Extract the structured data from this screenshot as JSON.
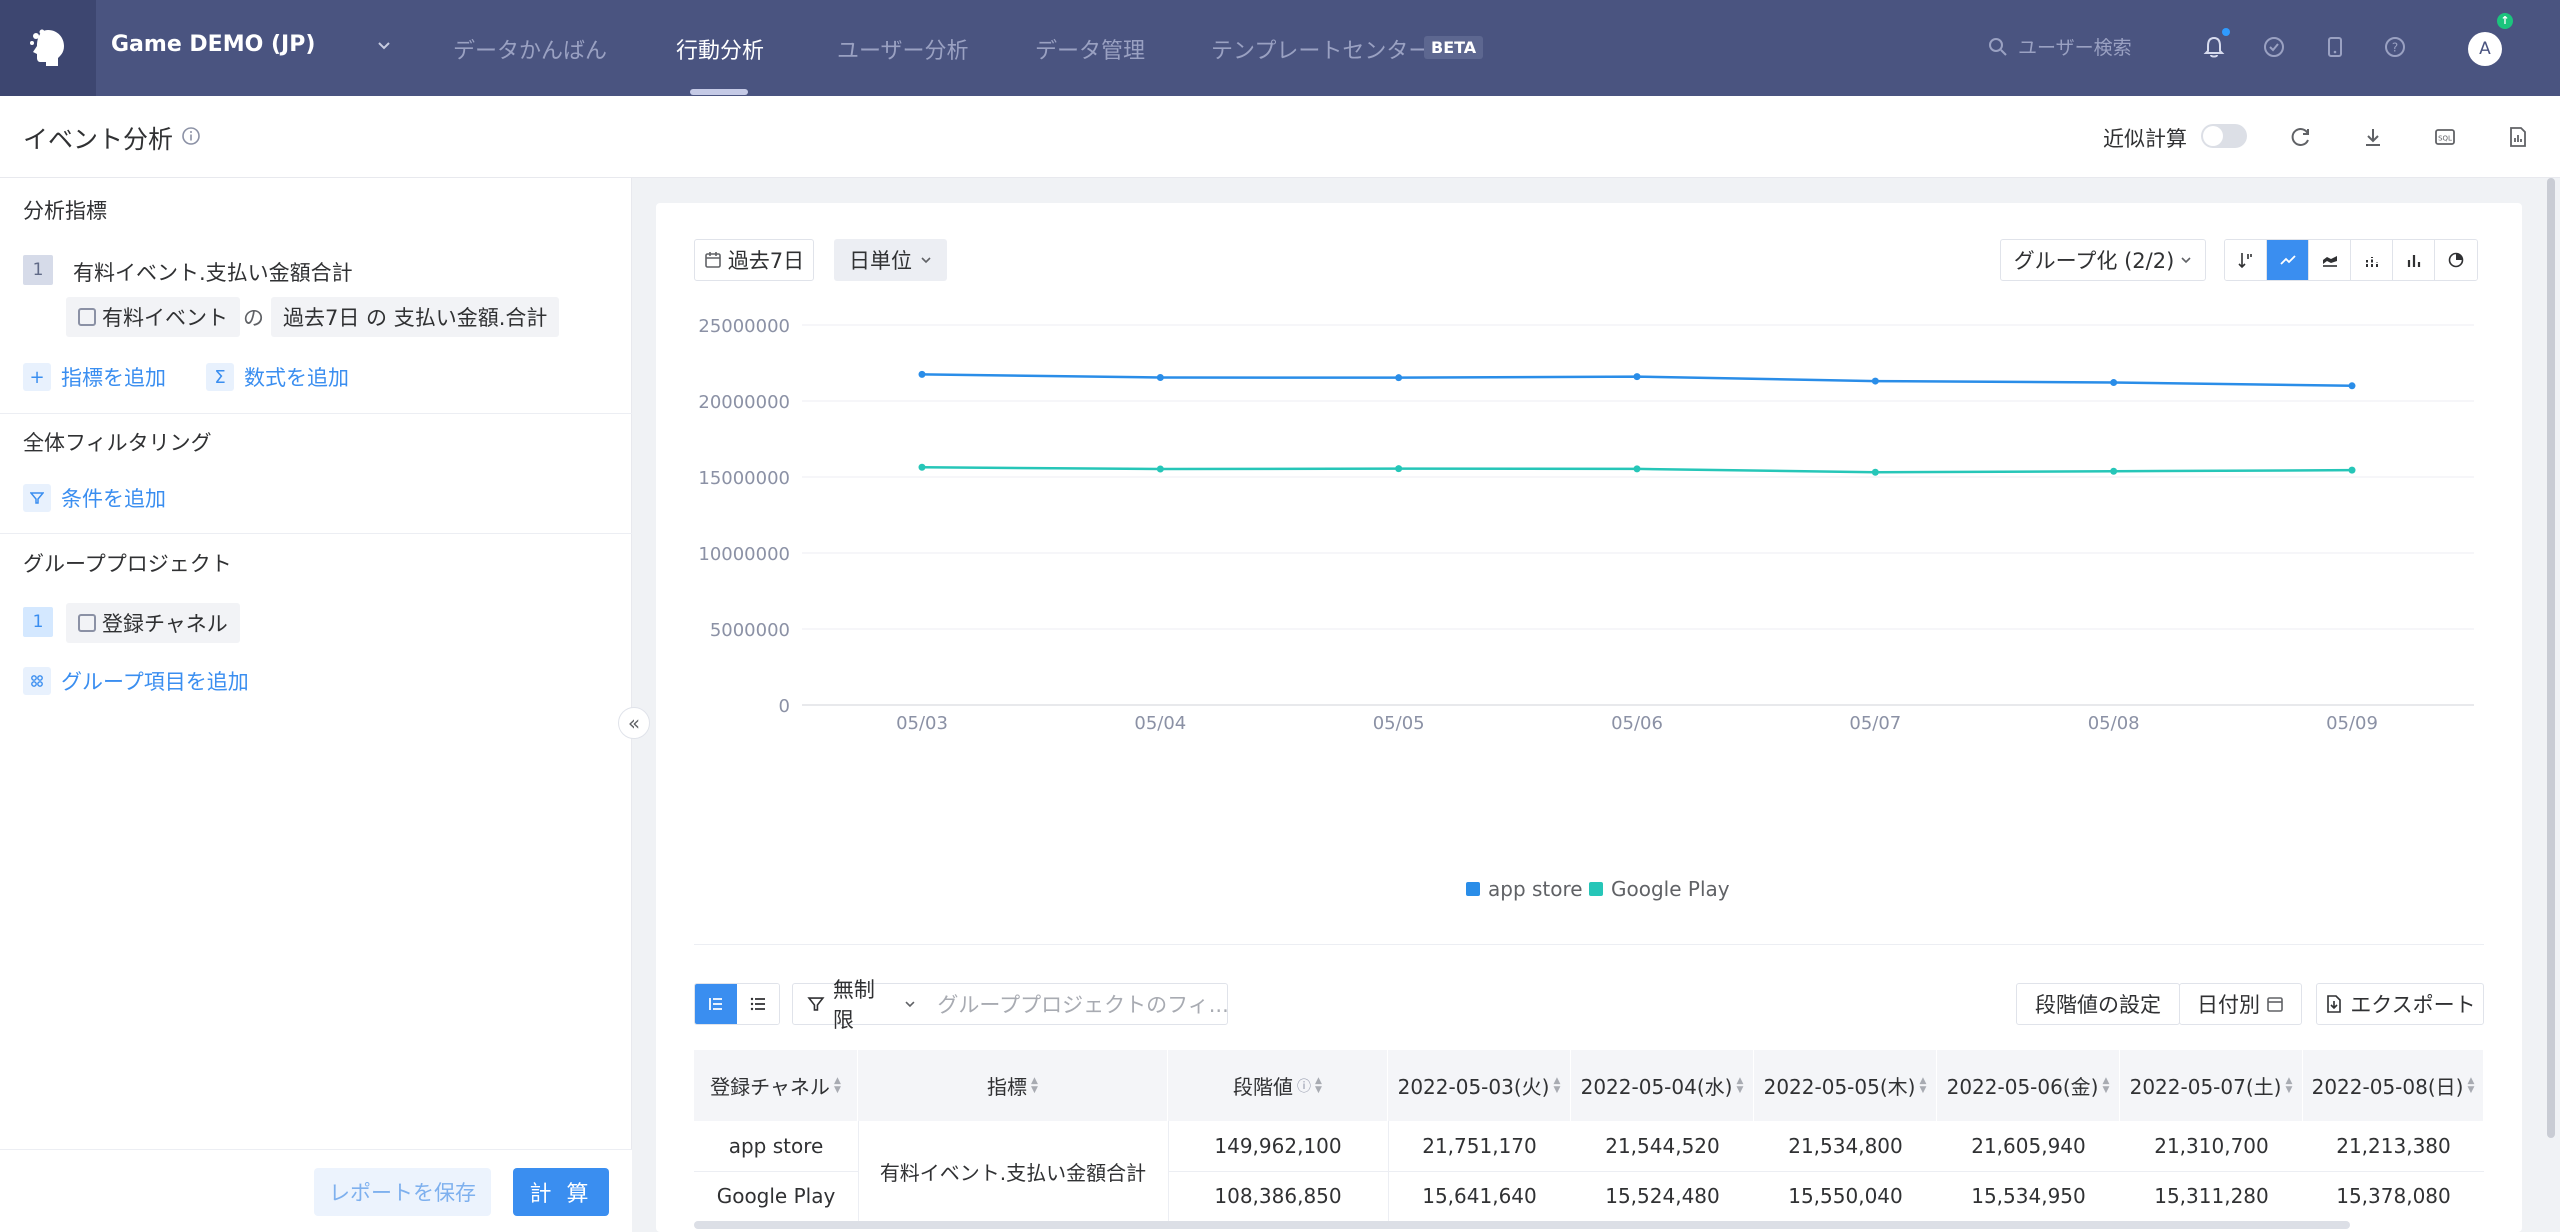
{
  "app": {
    "name": "Game DEMO (JP)"
  },
  "nav": {
    "items": [
      {
        "label": "データかんばん"
      },
      {
        "label": "行動分析"
      },
      {
        "label": "ユーザー分析"
      },
      {
        "label": "データ管理"
      },
      {
        "label": "テンプレートセンター"
      }
    ],
    "active": "行動分析",
    "beta": "BETA",
    "search_placeholder": "ユーザー検索",
    "avatar": "A"
  },
  "header": {
    "title": "イベント分析",
    "approx_label": "近似計算",
    "approx_enabled": false
  },
  "left_panel": {
    "metrics_title": "分析指標",
    "metric": {
      "index": "1",
      "name": "有料イベント.支払い金額合計",
      "event_chip": "有料イベント",
      "of": "の",
      "agg_chip": "過去7日 の 支払い金額.合計"
    },
    "add_metric": "指標を追加",
    "add_formula": "数式を追加",
    "filter_title": "全体フィルタリング",
    "add_condition": "条件を追加",
    "group_title": "グループプロジェクト",
    "group": {
      "index": "1",
      "chip": "登録チャネル"
    },
    "add_group": "グループ項目を追加",
    "save_report": "レポートを保存",
    "calculate": "計 算"
  },
  "toolbar": {
    "date_range": "過去7日",
    "granularity": "日単位",
    "group_by": "グループ化 (2/2)"
  },
  "chart_data": {
    "type": "line",
    "categories": [
      "05/03",
      "05/04",
      "05/05",
      "05/06",
      "05/07",
      "05/08",
      "05/09"
    ],
    "y_ticks": [
      "25000000",
      "20000000",
      "15000000",
      "10000000",
      "5000000",
      "0"
    ],
    "ylim": [
      0,
      25000000
    ],
    "grid": true,
    "legend_position": "bottom",
    "series": [
      {
        "name": "app store",
        "color": "#2a8de8",
        "values": [
          21751170,
          21544520,
          21534800,
          21605940,
          21310700,
          21213380,
          21000000
        ]
      },
      {
        "name": "Google Play",
        "color": "#26c6b8",
        "values": [
          15641640,
          15524480,
          15550040,
          15534950,
          15311280,
          15378080,
          15450000
        ]
      }
    ]
  },
  "table_toolbar": {
    "limit": "無制限",
    "filter_placeholder": "グループプロジェクトのフィ...",
    "stage_setting": "段階値の設定",
    "by_date": "日付別",
    "export": "エクスポート"
  },
  "table": {
    "headers": [
      "登録チャネル",
      "指標",
      "段階値",
      "2022-05-03(火)",
      "2022-05-04(水)",
      "2022-05-05(木)",
      "2022-05-06(金)",
      "2022-05-07(土)",
      "2022-05-08(日)"
    ],
    "metric_name": "有料イベント.支払い金額合計",
    "rows": [
      {
        "channel": "app store",
        "stage": "149,962,100",
        "values": [
          "21,751,170",
          "21,544,520",
          "21,534,800",
          "21,605,940",
          "21,310,700",
          "21,213,380"
        ]
      },
      {
        "channel": "Google Play",
        "stage": "108,386,850",
        "values": [
          "15,641,640",
          "15,524,480",
          "15,550,040",
          "15,534,950",
          "15,311,280",
          "15,378,080"
        ]
      }
    ]
  }
}
